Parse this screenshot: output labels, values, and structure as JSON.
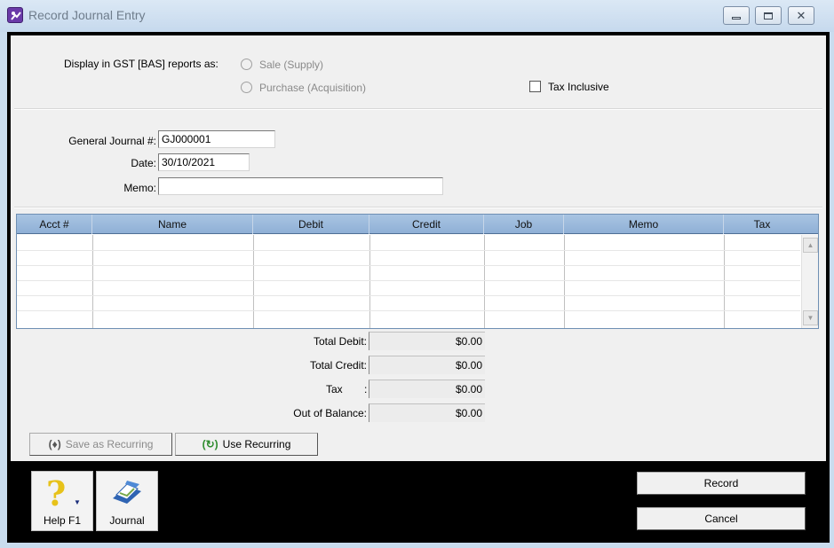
{
  "window": {
    "title": "Record Journal Entry",
    "buttons": [
      "minimize",
      "restore",
      "close"
    ]
  },
  "gst": {
    "label": "Display in GST [BAS] reports as:",
    "option_sale": "Sale (Supply)",
    "option_purchase": "Purchase (Acquisition)",
    "tax_inclusive": "Tax Inclusive"
  },
  "form": {
    "journal_label": "General Journal #:",
    "journal_value": "GJ000001",
    "date_label": "Date:",
    "date_value": "30/10/2021",
    "memo_label": "Memo:",
    "memo_value": ""
  },
  "grid": {
    "columns": [
      "Acct #",
      "Name",
      "Debit",
      "Credit",
      "Job",
      "Memo",
      "Tax"
    ]
  },
  "totals": {
    "debit_label": "Total Debit:",
    "debit": "$0.00",
    "credit_label": "Total Credit:",
    "credit": "$0.00",
    "tax_label": "Tax",
    "tax_colon": ":",
    "tax": "$0.00",
    "balance_label": "Out of Balance:",
    "balance": "$0.00"
  },
  "actions": {
    "save_recurring": "Save as Recurring",
    "use_recurring": "Use Recurring",
    "record": "Record",
    "cancel": "Cancel"
  },
  "toolbar": {
    "help": "Help F1",
    "journal": "Journal"
  },
  "colors": {
    "accent": "#8fb0d6",
    "frame": "#000000",
    "panel": "#f0f0f0"
  }
}
